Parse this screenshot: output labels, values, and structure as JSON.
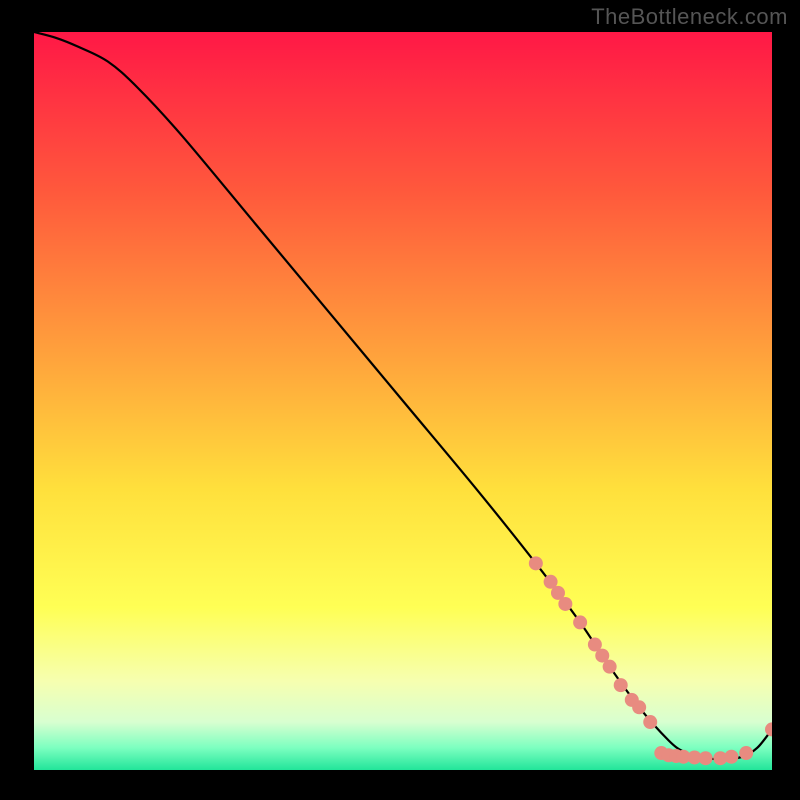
{
  "watermark": "TheBottleneck.com",
  "chart_data": {
    "type": "line",
    "title": "",
    "xlabel": "",
    "ylabel": "",
    "xlim": [
      0,
      100
    ],
    "ylim": [
      0,
      100
    ],
    "gradient_stops": [
      {
        "offset": 0,
        "color": "#ff1846"
      },
      {
        "offset": 0.22,
        "color": "#ff5a3c"
      },
      {
        "offset": 0.45,
        "color": "#ffa63c"
      },
      {
        "offset": 0.62,
        "color": "#ffe03c"
      },
      {
        "offset": 0.78,
        "color": "#ffff55"
      },
      {
        "offset": 0.88,
        "color": "#f6ffb0"
      },
      {
        "offset": 0.935,
        "color": "#d8ffd0"
      },
      {
        "offset": 0.97,
        "color": "#7cffc0"
      },
      {
        "offset": 1.0,
        "color": "#22e59a"
      }
    ],
    "series": [
      {
        "name": "curve",
        "x": [
          0,
          3,
          6,
          10,
          14,
          20,
          30,
          40,
          50,
          60,
          68,
          74,
          78,
          82,
          86,
          88,
          90,
          92,
          94,
          96,
          98,
          100
        ],
        "y": [
          100,
          99.2,
          98.0,
          96.0,
          92.5,
          86.0,
          74.0,
          62.0,
          50.0,
          38.0,
          28.0,
          20.0,
          14.0,
          8.5,
          4.0,
          2.5,
          1.8,
          1.5,
          1.5,
          1.8,
          3.0,
          5.5
        ]
      }
    ],
    "markers": {
      "color": "#e88b80",
      "radius_px": 7,
      "points": [
        {
          "x": 68,
          "y": 28.0
        },
        {
          "x": 70,
          "y": 25.5
        },
        {
          "x": 71,
          "y": 24.0
        },
        {
          "x": 72,
          "y": 22.5
        },
        {
          "x": 74,
          "y": 20.0
        },
        {
          "x": 76,
          "y": 17.0
        },
        {
          "x": 77,
          "y": 15.5
        },
        {
          "x": 78,
          "y": 14.0
        },
        {
          "x": 79.5,
          "y": 11.5
        },
        {
          "x": 81,
          "y": 9.5
        },
        {
          "x": 82,
          "y": 8.5
        },
        {
          "x": 83.5,
          "y": 6.5
        },
        {
          "x": 85,
          "y": 2.3
        },
        {
          "x": 86,
          "y": 2.0
        },
        {
          "x": 87,
          "y": 1.9
        },
        {
          "x": 88,
          "y": 1.8
        },
        {
          "x": 89.5,
          "y": 1.7
        },
        {
          "x": 91,
          "y": 1.6
        },
        {
          "x": 93,
          "y": 1.6
        },
        {
          "x": 94.5,
          "y": 1.8
        },
        {
          "x": 96.5,
          "y": 2.3
        },
        {
          "x": 100,
          "y": 5.5
        }
      ]
    }
  }
}
